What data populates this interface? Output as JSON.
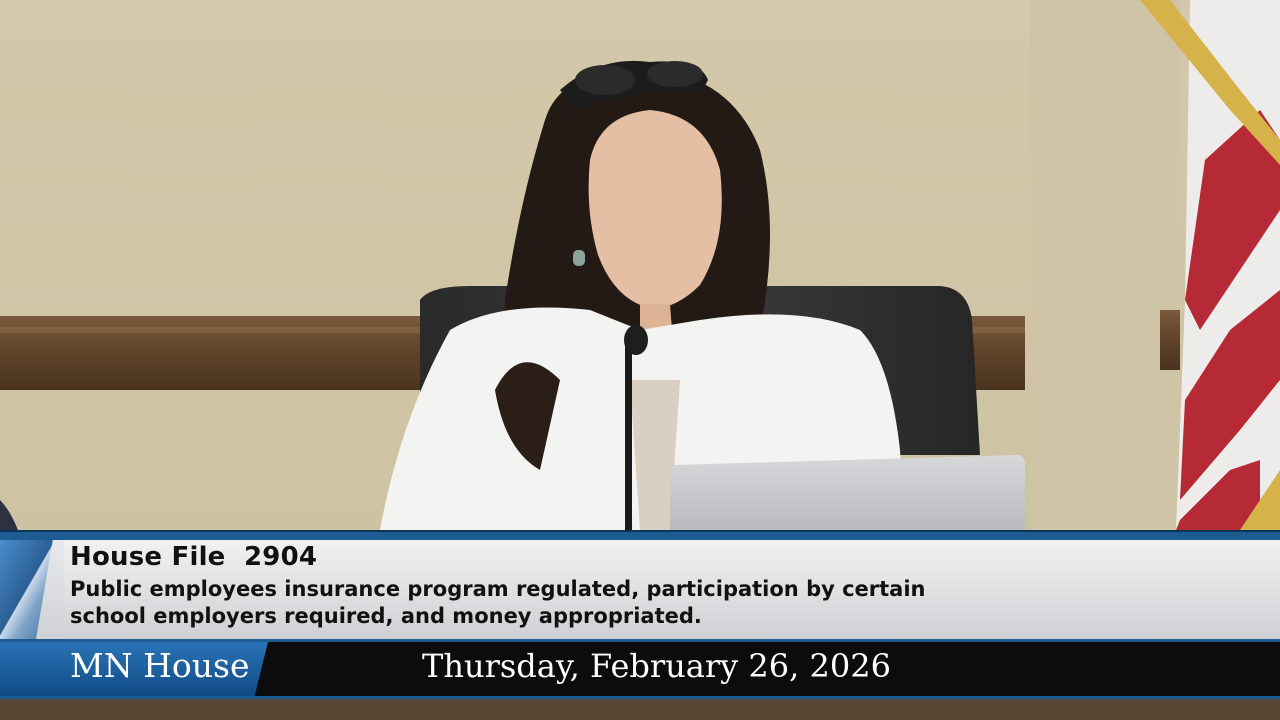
{
  "caption": {
    "bill_title": "House File  2904",
    "bill_summary": "Public employees insurance program regulated, participation by certain school employers required, and money appropriated."
  },
  "footer": {
    "channel": "MN House",
    "date": "Thursday, February 26, 2026"
  },
  "colors": {
    "accent_blue": "#1d5c93",
    "panel_gray": "#dedfe1",
    "bar_black": "#0c0c0c",
    "text_dark": "#111111"
  }
}
